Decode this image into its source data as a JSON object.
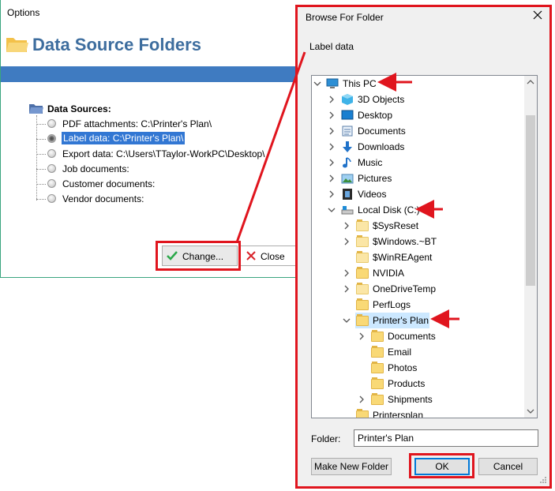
{
  "options_window": {
    "title": "Options",
    "header_title": "Data Source Folders",
    "tree_root_label": "Data Sources:",
    "sources": [
      {
        "label": "PDF attachments: C:\\Printer's Plan\\",
        "selected": false
      },
      {
        "label": "Label data: C:\\Printer's Plan\\",
        "selected": true
      },
      {
        "label": "Export data: C:\\Users\\TTaylor-WorkPC\\Desktop\\",
        "selected": false
      },
      {
        "label": "Job documents:",
        "selected": false
      },
      {
        "label": "Customer documents:",
        "selected": false
      },
      {
        "label": "Vendor documents:",
        "selected": false
      }
    ],
    "change_button": "Change...",
    "close_button": "Close"
  },
  "browse_dialog": {
    "title": "Browse For Folder",
    "description": "Label data",
    "tree": [
      {
        "label": "This PC",
        "icon": "computer-icon",
        "level": 0,
        "expanded": true
      },
      {
        "label": "3D Objects",
        "icon": "cube-icon",
        "level": 1
      },
      {
        "label": "Desktop",
        "icon": "desktop-icon",
        "level": 1
      },
      {
        "label": "Documents",
        "icon": "documents-icon",
        "level": 1
      },
      {
        "label": "Downloads",
        "icon": "download-icon",
        "level": 1
      },
      {
        "label": "Music",
        "icon": "music-icon",
        "level": 1
      },
      {
        "label": "Pictures",
        "icon": "pictures-icon",
        "level": 1
      },
      {
        "label": "Videos",
        "icon": "videos-icon",
        "level": 1
      },
      {
        "label": "Local Disk (C:)",
        "icon": "drive-icon",
        "level": 1,
        "expanded": true
      },
      {
        "label": "$SysReset",
        "icon": "folder-icon",
        "level": 2
      },
      {
        "label": "$Windows.~BT",
        "icon": "folder-icon",
        "level": 2
      },
      {
        "label": "$WinREAgent",
        "icon": "folder-icon",
        "level": 2
      },
      {
        "label": "NVIDIA",
        "icon": "folder-icon",
        "level": 2
      },
      {
        "label": "OneDriveTemp",
        "icon": "folder-icon",
        "level": 2
      },
      {
        "label": "PerfLogs",
        "icon": "folder-icon",
        "level": 2
      },
      {
        "label": "Printer's Plan",
        "icon": "folder-icon",
        "level": 2,
        "expanded": true,
        "selected": true
      },
      {
        "label": "Documents",
        "icon": "folder-icon",
        "level": 3
      },
      {
        "label": "Email",
        "icon": "folder-icon",
        "level": 3
      },
      {
        "label": "Photos",
        "icon": "folder-icon",
        "level": 3
      },
      {
        "label": "Products",
        "icon": "folder-icon",
        "level": 3
      },
      {
        "label": "Shipments",
        "icon": "folder-icon",
        "level": 3
      },
      {
        "label": "Printersplan",
        "icon": "folder-icon",
        "level": 2
      }
    ],
    "folder_label": "Folder:",
    "folder_value": "Printer's Plan",
    "make_new_folder_button": "Make New Folder",
    "ok_button": "OK",
    "cancel_button": "Cancel"
  },
  "colors": {
    "highlight_red": "#e0151e",
    "header_blue": "#3f7bc1",
    "title_blue": "#3d6d9e",
    "selection_blue": "#3277d3",
    "tree_selection": "#cce8ff"
  }
}
